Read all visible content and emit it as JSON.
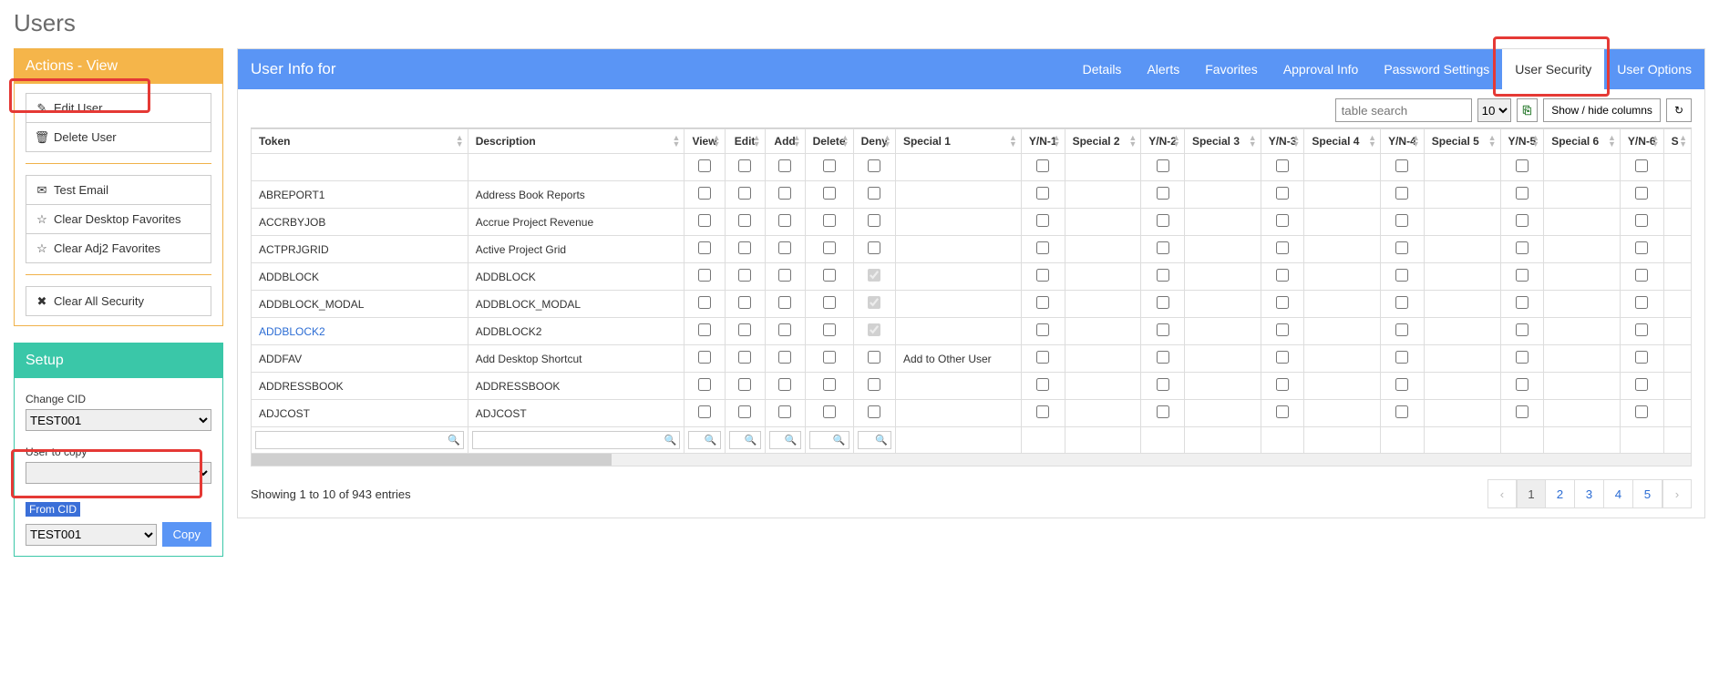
{
  "page_title": "Users",
  "actions": {
    "header": "Actions - View",
    "edit_user": "Edit User",
    "delete_user": "Delete User",
    "test_email": "Test Email",
    "clear_desktop_fav": "Clear Desktop Favorites",
    "clear_adj2_fav": "Clear Adj2 Favorites",
    "clear_all_security": "Clear All Security"
  },
  "setup": {
    "header": "Setup",
    "change_cid_label": "Change CID",
    "change_cid_value": "TEST001",
    "user_to_copy_label": "User to copy",
    "user_to_copy_value": "",
    "from_cid_label": "From CID",
    "from_cid_value": "TEST001",
    "copy_label": "Copy"
  },
  "main": {
    "title": "User Info for",
    "tabs": {
      "details": "Details",
      "alerts": "Alerts",
      "favorites": "Favorites",
      "approval": "Approval Info",
      "password": "Password Settings",
      "security": "User Security",
      "options": "User Options"
    },
    "search_placeholder": "table search",
    "page_size": "10",
    "show_hide": "Show / hide columns",
    "refresh_icon": "↻",
    "columns": [
      "Token",
      "Description",
      "View",
      "Edit",
      "Add",
      "Delete",
      "Deny",
      "Special 1",
      "Y/N-1",
      "Special 2",
      "Y/N-2",
      "Special 3",
      "Y/N-3",
      "Special 4",
      "Y/N-4",
      "Special 5",
      "Y/N-5",
      "Special 6",
      "Y/N-6",
      "S"
    ],
    "rows": [
      {
        "token": "",
        "desc": "",
        "deny": false,
        "special1": "",
        "link": false
      },
      {
        "token": "ABREPORT1",
        "desc": "Address Book Reports",
        "deny": false,
        "special1": "",
        "link": false
      },
      {
        "token": "ACCRBYJOB",
        "desc": "Accrue Project Revenue",
        "deny": false,
        "special1": "",
        "link": false
      },
      {
        "token": "ACTPRJGRID",
        "desc": "Active Project Grid",
        "deny": false,
        "special1": "",
        "link": false
      },
      {
        "token": "ADDBLOCK",
        "desc": "ADDBLOCK",
        "deny": true,
        "special1": "",
        "link": false
      },
      {
        "token": "ADDBLOCK_MODAL",
        "desc": "ADDBLOCK_MODAL",
        "deny": true,
        "special1": "",
        "link": false
      },
      {
        "token": "ADDBLOCK2",
        "desc": "ADDBLOCK2",
        "deny": true,
        "special1": "",
        "link": true
      },
      {
        "token": "ADDFAV",
        "desc": "Add Desktop Shortcut",
        "deny": false,
        "special1": "Add to Other User",
        "link": false
      },
      {
        "token": "ADDRESSBOOK",
        "desc": "ADDRESSBOOK",
        "deny": false,
        "special1": "",
        "link": false
      },
      {
        "token": "ADJCOST",
        "desc": "ADJCOST",
        "deny": false,
        "special1": "",
        "link": false
      }
    ],
    "footer": "Showing 1 to 10 of 943 entries",
    "pages": [
      "1",
      "2",
      "3",
      "4",
      "5"
    ]
  }
}
